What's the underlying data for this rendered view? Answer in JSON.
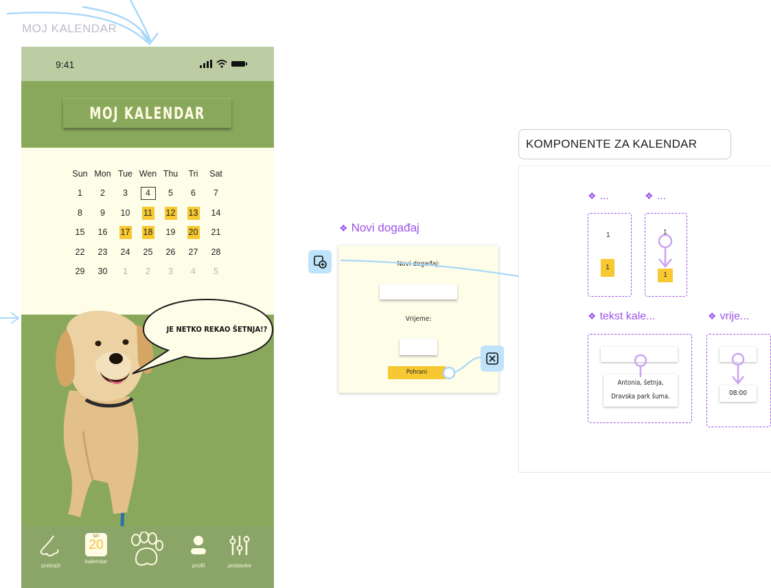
{
  "frame_label": "MOJ KALENDAR",
  "phone": {
    "status_time": "9:41",
    "title": "MOJ KALENDAR",
    "calendar": {
      "weekdays": [
        "Sun",
        "Mon",
        "Tue",
        "Wen",
        "Thu",
        "Tri",
        "Sat"
      ],
      "rows": [
        [
          "1",
          "2",
          "3",
          "4",
          "5",
          "6",
          "7"
        ],
        [
          "8",
          "9",
          "10",
          "11",
          "12",
          "13",
          "14"
        ],
        [
          "15",
          "16",
          "17",
          "18",
          "19",
          "20",
          "21"
        ],
        [
          "22",
          "23",
          "24",
          "25",
          "26",
          "27",
          "28"
        ],
        [
          "29",
          "30",
          "1",
          "2",
          "3",
          "4",
          "5"
        ]
      ],
      "today": "4",
      "highlighted": [
        "11",
        "12",
        "13",
        "17",
        "18",
        "20"
      ],
      "highlight_color": "#f7c832"
    },
    "speech_bubble": "JE NETKO REKAO ŠETNJA!?",
    "nav": {
      "items": [
        {
          "label": "pretraži",
          "icon": "nose-search-icon"
        },
        {
          "label": "kalendar",
          "icon": "calendar-icon",
          "icon_day": "SAT",
          "icon_date": "20"
        },
        {
          "label": "",
          "icon": "paw-icon"
        },
        {
          "label": "profil",
          "icon": "profile-icon"
        },
        {
          "label": "postavke",
          "icon": "settings-sliders-icon"
        }
      ]
    }
  },
  "novi_dogadjaj": {
    "component_title": "Novi događaj",
    "heading": "Novi događaj:",
    "time_label": "Vrijeme:",
    "save_label": "Pohrani"
  },
  "komponente": {
    "title": "KOMPONENTE ZA KALENDAR",
    "comp1_title": "...",
    "comp2_title": "...",
    "comp1_default": "1",
    "comp1_variant": "1",
    "comp2_default": "1",
    "comp2_variant": "1",
    "comp3_title": "tekst kale...",
    "comp3_text_line1": "Antonia, šetnja,",
    "comp3_text_line2": "Dravska park šuma.",
    "comp4_title": "vrije...",
    "comp4_time": "08:00"
  },
  "colors": {
    "accent_purple": "#9b52e6",
    "prototype_blue": "#a9d8fb",
    "olive_green": "#8aa85c",
    "cream": "#fdfde8",
    "yellow": "#f7c832"
  }
}
